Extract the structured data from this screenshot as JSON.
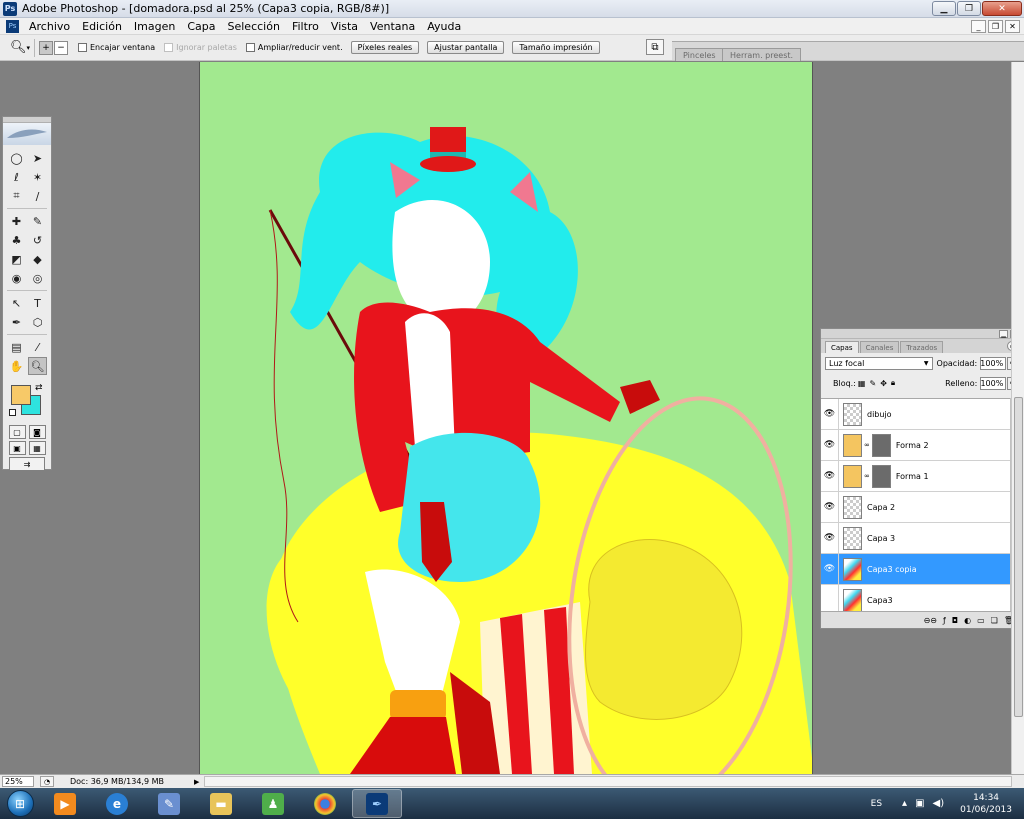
{
  "window": {
    "title": "Adobe Photoshop - [domadora.psd al 25% (Capa3 copia, RGB/8#)]",
    "app_icon": "Ps"
  },
  "menu": {
    "items": [
      "Archivo",
      "Edición",
      "Imagen",
      "Capa",
      "Selección",
      "Filtro",
      "Vista",
      "Ventana",
      "Ayuda"
    ]
  },
  "options": {
    "checkboxes": [
      "Encajar ventana",
      "Ignorar paletas",
      "Ampliar/reducir vent."
    ],
    "buttons": [
      "Píxeles reales",
      "Ajustar pantalla",
      "Tamaño impresión"
    ],
    "well_tabs": [
      "Pinceles",
      "Herram. preest."
    ]
  },
  "colors": {
    "foreground": "#f7c968",
    "background": "#2ee3df",
    "canvas": "#a2e98f",
    "selected_layer": "#3399ff"
  },
  "layers_panel": {
    "tabs": [
      "Capas",
      "Canales",
      "Trazados"
    ],
    "blend_mode": "Luz focal",
    "opacity_label": "Opacidad:",
    "opacity": "100%",
    "lock_label": "Bloq.:",
    "fill_label": "Relleno:",
    "fill": "100%",
    "layers": [
      {
        "name": "dibujo",
        "visible": true,
        "thumb": "transparent"
      },
      {
        "name": "Forma 2",
        "visible": true,
        "thumb": "fill",
        "mask": true
      },
      {
        "name": "Forma 1",
        "visible": true,
        "thumb": "fill",
        "mask": true
      },
      {
        "name": "Capa 2",
        "visible": true,
        "thumb": "transparent"
      },
      {
        "name": "Capa 3",
        "visible": true,
        "thumb": "transparent"
      },
      {
        "name": "Capa3 copia",
        "visible": true,
        "thumb": "art",
        "selected": true
      },
      {
        "name": "Capa3",
        "visible": false,
        "thumb": "art"
      }
    ]
  },
  "status": {
    "zoom": "25%",
    "doc": "Doc: 36,9 MB/134,9 MB"
  },
  "taskbar": {
    "lang": "ES",
    "time": "14:34",
    "date": "01/06/2013"
  }
}
